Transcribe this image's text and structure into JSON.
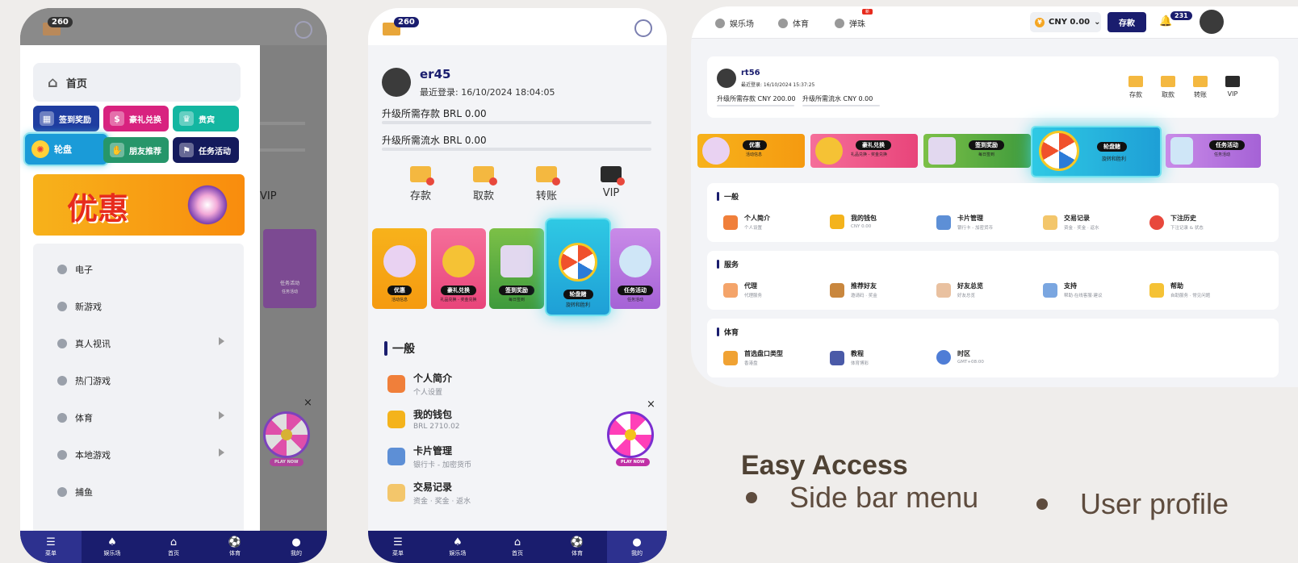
{
  "colors": {
    "navy": "#1a1d6e",
    "accent_teal": "#1fc2d8",
    "caption": "#5e4c3e"
  },
  "phone1": {
    "mail_count": "260",
    "drawer": {
      "home": "首页",
      "quick": [
        {
          "label": "签到奖励",
          "color": "#1f3da0"
        },
        {
          "label": "豪礼兑换",
          "color": "#d8227f"
        },
        {
          "label": "贵宾",
          "color": "#13b6a1"
        },
        {
          "label": "轮盘",
          "color": "#1a9bd8"
        },
        {
          "label": "朋友推荐",
          "color": "#26966a"
        },
        {
          "label": "任务活动",
          "color": "#141a5c"
        }
      ],
      "promo": "优惠",
      "menu": [
        "电子",
        "新游戏",
        "真人视讯",
        "热门游戏",
        "体育",
        "本地游戏",
        "捕鱼"
      ]
    },
    "behind_vip": "VIP",
    "behind_card": {
      "title": "任务活动",
      "sub": "任务活动"
    },
    "wheel_center": "9.0",
    "play_now": "PLAY NOW",
    "close": "×"
  },
  "nav": {
    "menu": "菜单",
    "casino": "娱乐场",
    "home": "首页",
    "sports": "体育",
    "mine": "我的"
  },
  "phone2": {
    "mail_count": "260",
    "username": "er45",
    "last_login": "最近登录: 16/10/2024 18:04:05",
    "upgrade_deposit": "升级所需存款 BRL 0.00",
    "upgrade_turnover": "升级所需流水 BRL 0.00",
    "actions": [
      "存款",
      "取款",
      "转账",
      "VIP"
    ],
    "cards": [
      {
        "title": "优惠",
        "sub": "活动信息"
      },
      {
        "title": "豪礼兑换",
        "sub": "礼品兑换 - 奖金兑换"
      },
      {
        "title": "签到奖励",
        "sub": "每日签到"
      },
      {
        "title": "轮盘赌",
        "sub": "旋转和胜利"
      },
      {
        "title": "任务活动",
        "sub": "任务活动"
      }
    ],
    "section": "一般",
    "list": [
      {
        "title": "个人简介",
        "sub": "个人设置"
      },
      {
        "title": "我的钱包",
        "sub": "BRL 2710.02"
      },
      {
        "title": "卡片管理",
        "sub": "银行卡 - 加密货币"
      },
      {
        "title": "交易记录",
        "sub": "资金 · 奖金 · 返水"
      }
    ],
    "wheel_center": "9.0",
    "play_now": "PLAY NOW",
    "close": "×"
  },
  "tablet": {
    "nav": {
      "casino": "娱乐场",
      "sports": "体育",
      "marbles": "弹珠",
      "new_badge": "新"
    },
    "balance": "CNY 0.00",
    "deposit": "存款",
    "notif_count": "231",
    "username": "rt56",
    "last_login": "最近登录: 16/10/2024 15:37:25",
    "upgrade_deposit": "升级所需存款 CNY 200.00",
    "upgrade_turnover": "升级所需流水 CNY 0.00",
    "actions": [
      "存款",
      "取款",
      "转账",
      "VIP"
    ],
    "cards": [
      {
        "title": "优惠",
        "sub": "活动信息"
      },
      {
        "title": "豪礼兑换",
        "sub": "礼品兑换 - 奖金兑换"
      },
      {
        "title": "签到奖励",
        "sub": "每日签到"
      },
      {
        "title": "轮盘赌",
        "sub": "旋转和胜利"
      },
      {
        "title": "任务活动",
        "sub": "任务活动"
      }
    ],
    "general": {
      "title": "一般",
      "items": [
        {
          "title": "个人简介",
          "sub": "个人设置"
        },
        {
          "title": "我的钱包",
          "sub": "CNY 0.00"
        },
        {
          "title": "卡片管理",
          "sub": "银行卡 - 加密货币"
        },
        {
          "title": "交易记录",
          "sub": "资金 · 奖金 · 返水"
        },
        {
          "title": "下注历史",
          "sub": "下注记录 & 状态"
        }
      ]
    },
    "service": {
      "title": "服务",
      "items": [
        {
          "title": "代理",
          "sub": "代理服务"
        },
        {
          "title": "推荐好友",
          "sub": "邀请码 · 奖金"
        },
        {
          "title": "好友总览",
          "sub": "好友总览"
        },
        {
          "title": "支持",
          "sub": "帮助·在线客服·建议"
        },
        {
          "title": "帮助",
          "sub": "自助服务 · 常见问题"
        }
      ]
    },
    "sports": {
      "title": "体育",
      "items": [
        {
          "title": "首选盘口类型",
          "sub": "香港盘"
        },
        {
          "title": "教程",
          "sub": "体育博彩"
        },
        {
          "title": "时区",
          "sub": "GMT+08:00"
        }
      ]
    }
  },
  "caption": {
    "title": "Easy Access",
    "bullet1": "Side bar menu",
    "bullet2": "User profile"
  }
}
